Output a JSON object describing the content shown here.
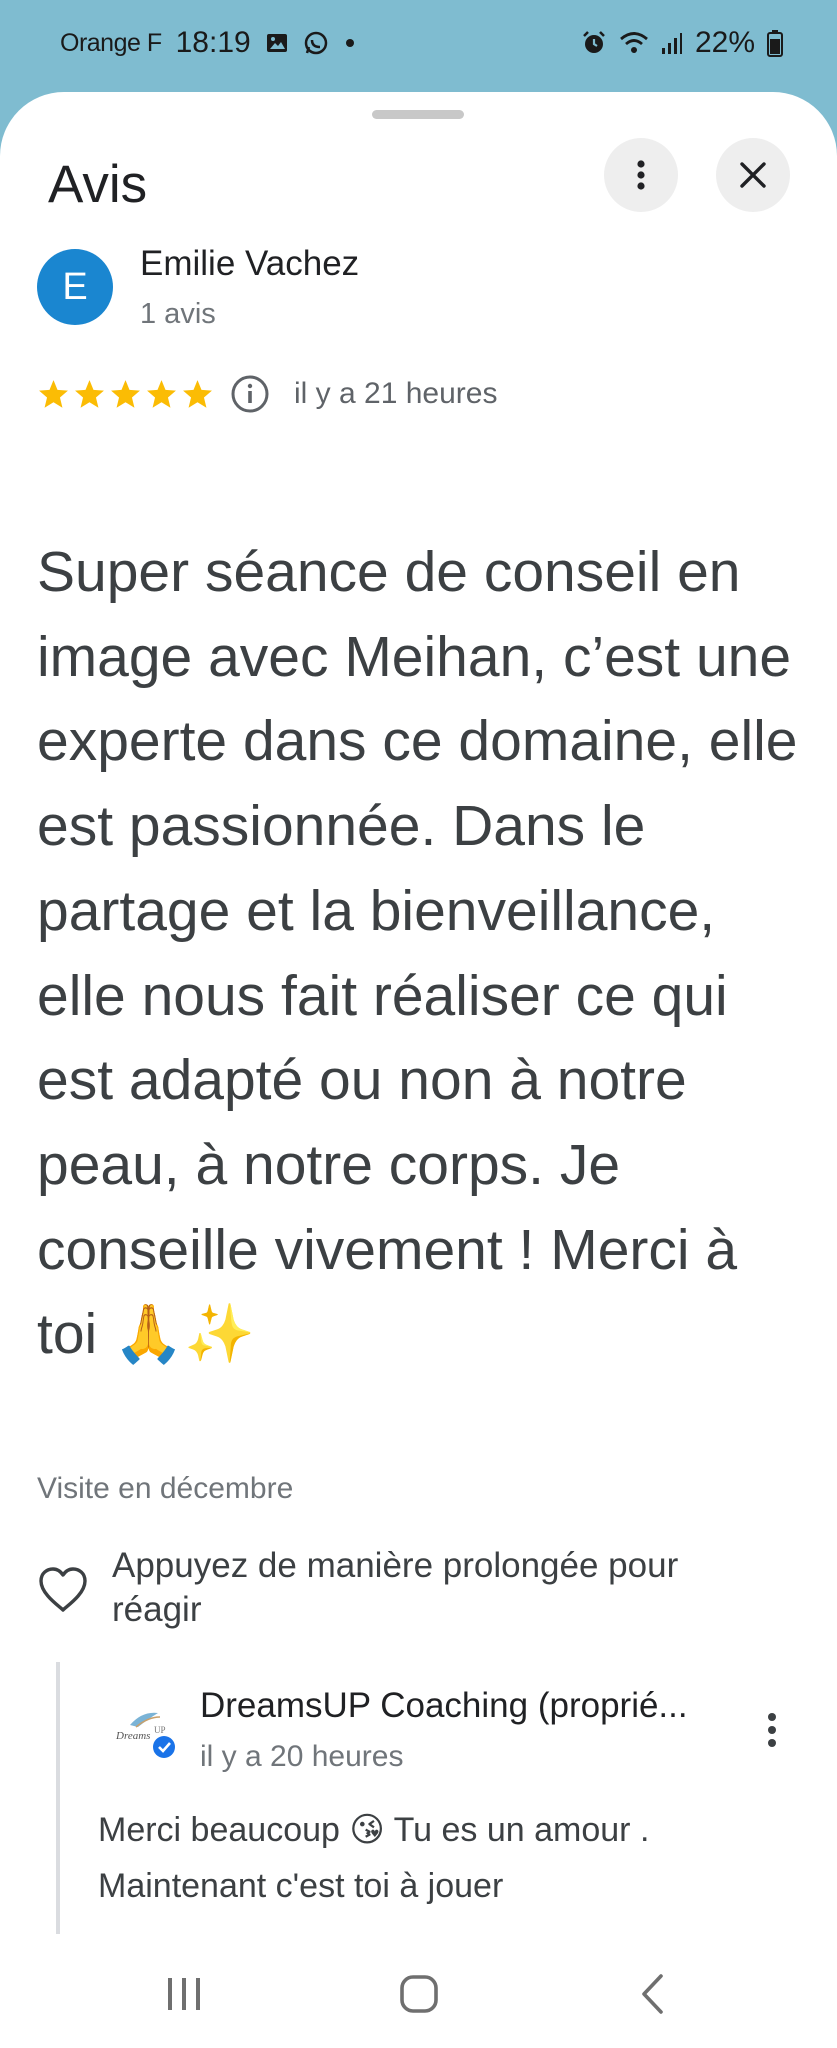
{
  "status_bar": {
    "carrier": "Orange F",
    "time": "18:19",
    "battery": "22%",
    "icons_left": [
      "gallery-icon",
      "whatsapp-icon",
      "dot-icon"
    ],
    "icons_right": [
      "alarm-icon",
      "wifi-icon",
      "signal-icon",
      "battery-icon"
    ]
  },
  "sheet": {
    "title": "Avis",
    "more_icon": "more-vert-icon",
    "close_icon": "close-icon"
  },
  "review": {
    "avatar_letter": "E",
    "avatar_color": "#1a86d0",
    "reviewer_name": "Emilie Vachez",
    "reviewer_count": "1 avis",
    "rating": 5,
    "rating_max": 5,
    "star_color": "#fbbc04",
    "time": "il y a 21 heures",
    "text": "Super séance de conseil en image avec Meihan, c’est une experte dans ce domaine, elle est passionnée. Dans le partage et la bienveillance, elle nous fait réaliser ce qui est adapté ou non à notre peau, à notre corps. Je conseille vivement ! Merci à toi 🙏✨",
    "visit": "Visite en décembre",
    "react_label": "Appuyez de manière prolongée pour réagir"
  },
  "owner_reply": {
    "name": "DreamsUP Coaching (proprié...",
    "time": "il y a 20 heures",
    "text": "Merci beaucoup 😘 Tu es un amour . Maintenant c'est toi à jouer",
    "verified_color": "#1a73e8"
  },
  "nav_bar": {
    "recent_icon": "recent-apps-icon",
    "home_icon": "home-icon",
    "back_icon": "back-icon"
  }
}
